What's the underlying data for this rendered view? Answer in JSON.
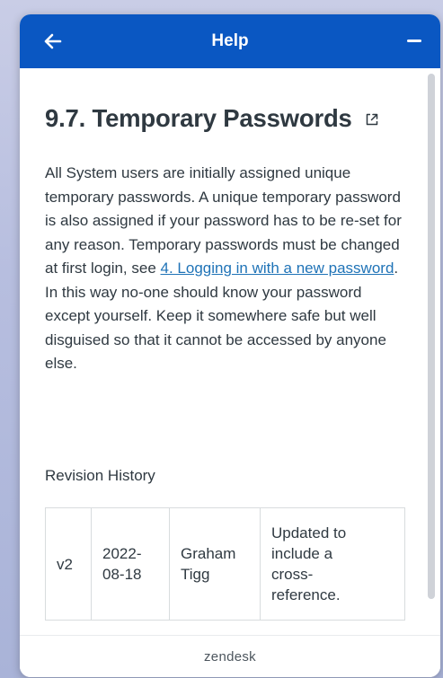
{
  "header": {
    "title": "Help",
    "back_icon": "arrow-left-icon",
    "minimize_icon": "minimize-icon"
  },
  "article": {
    "title": "9.7. Temporary Passwords",
    "external_icon": "external-link-icon",
    "body_before_link": "All System users are initially assigned unique temporary passwords. A unique temporary password is also assigned if your password has to be re-set for any reason. Temporary passwords must be changed at first login, see ",
    "link_text": "4. Logging in with a new password",
    "body_after_link": ". In this way no-one should know your password except yourself. Keep it somewhere safe but well disguised so that it cannot be accessed by anyone else."
  },
  "revision_history": {
    "heading": "Revision History",
    "rows": [
      {
        "version": "v2",
        "date_line1": "2022-",
        "date_line2": "08-18",
        "author_line1": "Graham",
        "author_line2": "Tigg",
        "change_line1": "Updated to",
        "change_line2": "include a",
        "change_line3": "cross-",
        "change_line4": "reference."
      }
    ]
  },
  "footer": {
    "brand": "zendesk"
  },
  "colors": {
    "header_bg": "#0a57c2",
    "link": "#1f73b7",
    "text": "#2f3941"
  }
}
